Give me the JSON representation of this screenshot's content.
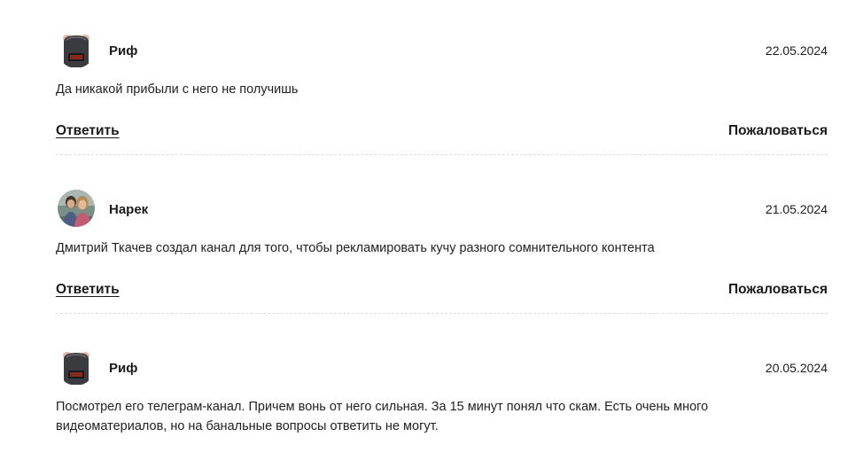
{
  "comments": [
    {
      "author": "Риф",
      "avatar": "helmet-avatar",
      "date": "22.05.2024",
      "text": "Да никакой прибыли с него не получишь",
      "reply_label": "Ответить",
      "report_label": "Пожаловаться"
    },
    {
      "author": "Нарек",
      "avatar": "photo-avatar",
      "date": "21.05.2024",
      "text": "Дмитрий Ткачев создал канал для того, чтобы рекламировать кучу разного сомнительного контента",
      "reply_label": "Ответить",
      "report_label": "Пожаловаться"
    },
    {
      "author": "Риф",
      "avatar": "helmet-avatar",
      "date": "20.05.2024",
      "text": "Посмотрел его телеграм-канал. Причем вонь от него сильная. За 15 минут понял что скам. Есть очень много видеоматериалов, но на банальные вопросы ответить не могут."
    }
  ]
}
